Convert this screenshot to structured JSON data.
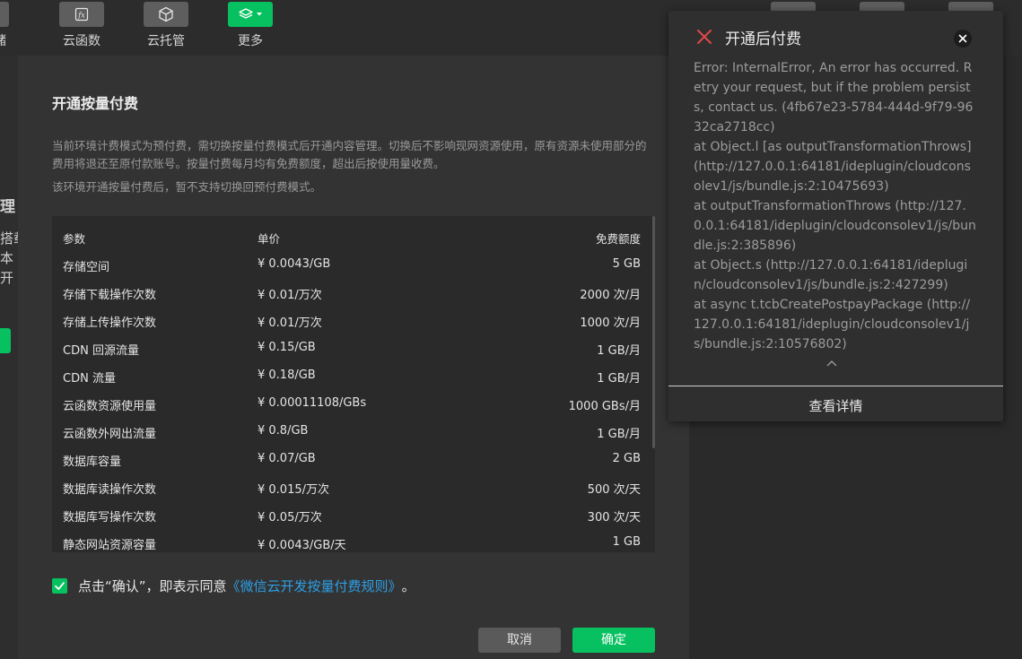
{
  "toolbar": {
    "cut_label": "储",
    "items": [
      {
        "label": "云函数",
        "icon": "function-icon"
      },
      {
        "label": "云托管",
        "icon": "cube-icon"
      },
      {
        "label": "更多",
        "icon": "layers-icon"
      }
    ]
  },
  "background": {
    "left_fragments": [
      "理",
      "搭载",
      "本",
      "开"
    ]
  },
  "dialog": {
    "title": "开通按量付费",
    "description": "当前环境计费模式为预付费，需切换按量付费模式后开通内容管理。切换后不影响现网资源使用，原有资源未使用部分的费用将退还至原付款账号。按量付费每月均有免费额度，超出后按使用量收费。",
    "note": "该环境开通按量付费后，暂不支持切换回预付费模式。",
    "table": {
      "headers": [
        "参数",
        "单价",
        "免费额度"
      ],
      "rows": [
        [
          "存储空间",
          "¥ 0.0043/GB",
          "5 GB"
        ],
        [
          "存储下载操作次数",
          "¥ 0.01/万次",
          "2000 次/月"
        ],
        [
          "存储上传操作次数",
          "¥ 0.01/万次",
          "1000 次/月"
        ],
        [
          "CDN 回源流量",
          "¥ 0.15/GB",
          "1 GB/月"
        ],
        [
          "CDN 流量",
          "¥ 0.18/GB",
          "1 GB/月"
        ],
        [
          "云函数资源使用量",
          "¥ 0.00011108/GBs",
          "1000 GBs/月"
        ],
        [
          "云函数外网出流量",
          "¥ 0.8/GB",
          "1 GB/月"
        ],
        [
          "数据库容量",
          "¥ 0.07/GB",
          "2 GB"
        ],
        [
          "数据库读操作次数",
          "¥ 0.015/万次",
          "500 次/天"
        ],
        [
          "数据库写操作次数",
          "¥ 0.05/万次",
          "300 次/天"
        ],
        [
          "静态网站资源容量",
          "¥ 0.0043/GB/天",
          "1 GB"
        ]
      ]
    },
    "agree": {
      "checked": true,
      "prefix": "点击“确认”，即表示同意",
      "link": "《微信云开发按量付费规则》",
      "suffix": "。"
    },
    "cancel_label": "取消",
    "ok_label": "确定"
  },
  "toast": {
    "title": "开通后付费",
    "message": "Error: InternalError, An error has occurred. Retry your request, but if the problem persists, contact us. (4fb67e23-5784-444d-9f79-9632ca2718cc)\nat Object.l [as outputTransformationThrows] (http://127.0.0.1:64181/ideplugin/cloudconsolev1/js/bundle.js:2:10475693)\nat outputTransformationThrows (http://127.0.0.1:64181/ideplugin/cloudconsolev1/js/bundle.js:2:385896)\nat Object.s (http://127.0.0.1:64181/ideplugin/cloudconsolev1/js/bundle.js:2:427299)\nat async t.tcbCreatePostpayPackage (http://127.0.0.1:64181/ideplugin/cloudconsolev1/js/bundle.js:2:10576802)",
    "details_label": "查看详情"
  },
  "colors": {
    "accent": "#07c160",
    "link": "#2e9fe6",
    "error": "#e04848"
  }
}
